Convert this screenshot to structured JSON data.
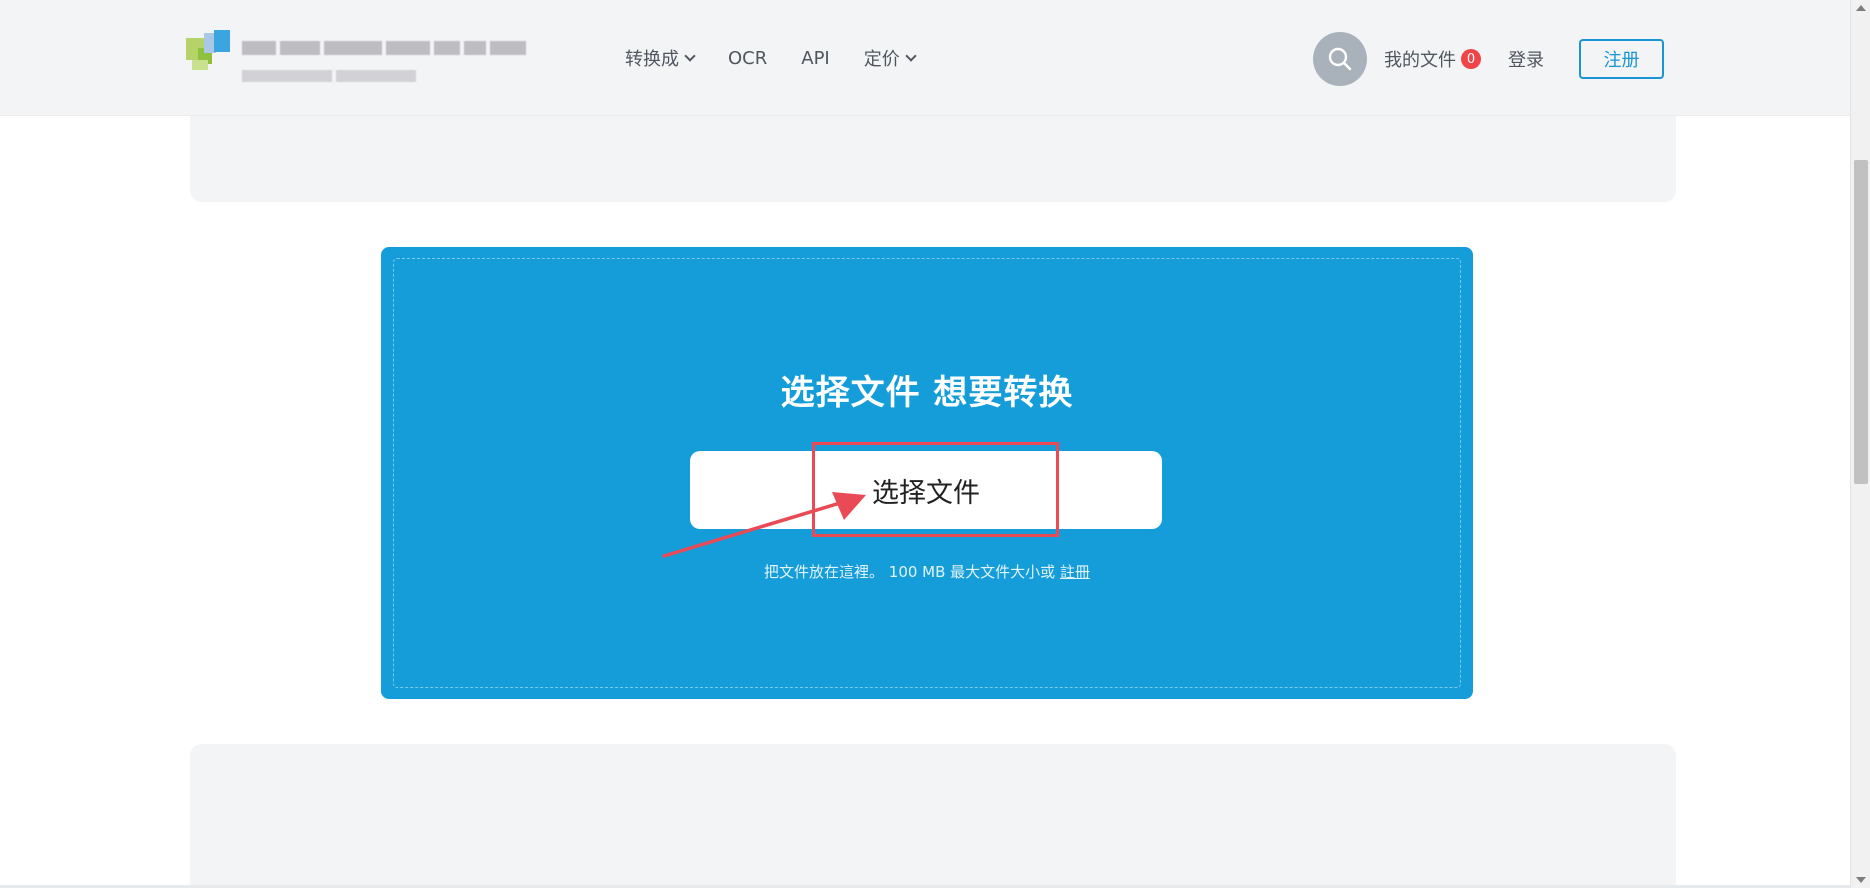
{
  "header": {
    "nav": [
      {
        "label": "转换成",
        "has_caret": true
      },
      {
        "label": "OCR",
        "has_caret": false
      },
      {
        "label": "API",
        "has_caret": false
      },
      {
        "label": "定价",
        "has_caret": true
      }
    ],
    "search_icon": "search-icon",
    "my_files_label": "我的文件",
    "my_files_count": "0",
    "login_label": "登录",
    "register_label": "注册"
  },
  "upload": {
    "title": "选择文件 想要转换",
    "button_label": "选择文件",
    "hint_text": "把文件放在這裡。 100 MB 最大文件大小或",
    "hint_link": "註冊"
  },
  "colors": {
    "accent": "#149dd9",
    "button_border": "#1a95d3",
    "badge": "#f0434a",
    "annotation": "#ea4a55"
  }
}
